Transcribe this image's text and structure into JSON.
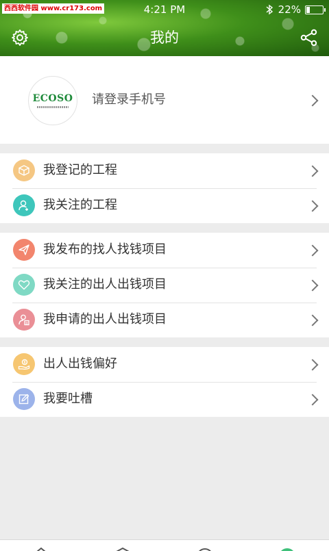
{
  "watermark": "西西软件园 www.cr173.com",
  "status_bar": {
    "time": "4:21 PM",
    "battery": "22%",
    "battery_level": 0.22
  },
  "header": {
    "title": "我的"
  },
  "profile": {
    "logo_text": "ECOSO",
    "login_prompt": "请登录手机号"
  },
  "groups": [
    {
      "items": [
        {
          "label": "我登记的工程",
          "icon": "box-icon",
          "color": "#f5c783"
        },
        {
          "label": "我关注的工程",
          "icon": "user-add-icon",
          "color": "#3ec6bb"
        }
      ]
    },
    {
      "items": [
        {
          "label": "我发布的找人找钱项目",
          "icon": "paper-plane-icon",
          "color": "#f2856d"
        },
        {
          "label": "我关注的出人出钱项目",
          "icon": "heart-icon",
          "color": "#7fd9c4"
        },
        {
          "label": "我申请的出人出钱项目",
          "icon": "user-doc-icon",
          "color": "#ea8f96"
        }
      ]
    },
    {
      "items": [
        {
          "label": "出人出钱偏好",
          "icon": "money-hand-icon",
          "color": "#f6c671"
        },
        {
          "label": "我要吐槽",
          "icon": "edit-icon",
          "color": "#9cb3ea"
        }
      ]
    }
  ],
  "bottom_nav": {
    "tabs": [
      "home-tab",
      "project-tab",
      "search-tab",
      "mine-tab"
    ]
  }
}
